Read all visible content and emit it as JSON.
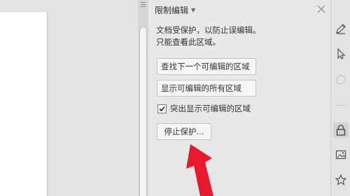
{
  "pane": {
    "title": "限制编辑",
    "description_lines": [
      "文档受保护，以防止误编辑。",
      "只能查看此区域。"
    ],
    "find_next_button": "查找下一个可编辑的区域",
    "show_all_button": "显示可编辑的所有区域",
    "highlight_checkbox": {
      "label": "突出显示可编辑的区域",
      "checked": true
    },
    "stop_protection_button": "停止保护..."
  },
  "annotation": {
    "color": "#e8192c"
  },
  "toolbar": {
    "icons": [
      "pen-icon",
      "cursor-icon",
      "shape-icon",
      "lock-icon",
      "image-icon",
      "star-icon"
    ],
    "active": "lock-icon"
  }
}
